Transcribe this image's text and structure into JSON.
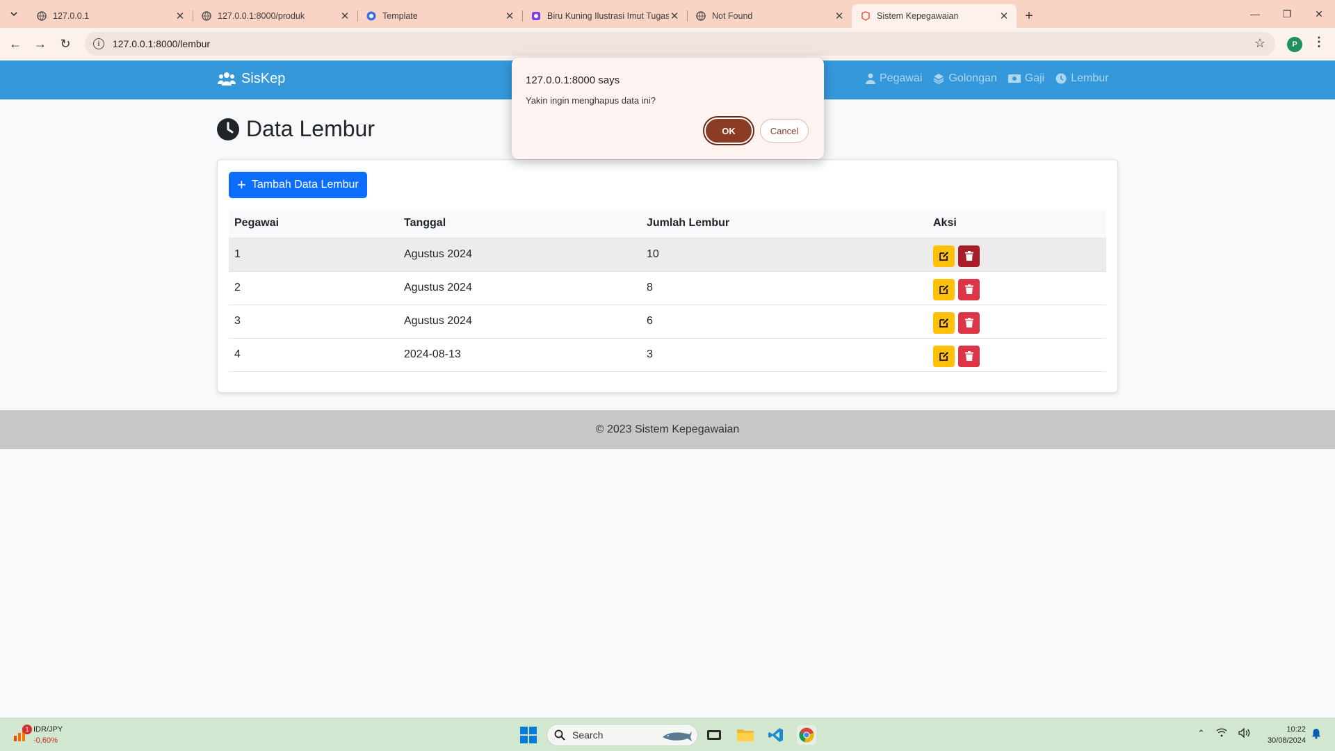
{
  "browser": {
    "tabs": [
      {
        "title": "127.0.0.1",
        "active": false
      },
      {
        "title": "127.0.0.1:8000/produk",
        "active": false
      },
      {
        "title": "Template",
        "active": false
      },
      {
        "title": "Biru Kuning Ilustrasi Imut Tugas",
        "active": false
      },
      {
        "title": "Not Found",
        "active": false
      },
      {
        "title": "Sistem Kepegawaian",
        "active": true
      }
    ],
    "url": "127.0.0.1:8000/lembur",
    "profile_initial": "P"
  },
  "navbar": {
    "brand": "SisKep",
    "links": [
      "Pegawai",
      "Golongan",
      "Gaji",
      "Lembur"
    ]
  },
  "page": {
    "title": "Data Lembur",
    "add_button": "Tambah Data Lembur"
  },
  "table": {
    "headers": [
      "Pegawai",
      "Tanggal",
      "Jumlah Lembur",
      "Aksi"
    ],
    "rows": [
      {
        "pegawai": "1",
        "tanggal": "Agustus 2024",
        "jumlah": "10"
      },
      {
        "pegawai": "2",
        "tanggal": "Agustus 2024",
        "jumlah": "8"
      },
      {
        "pegawai": "3",
        "tanggal": "Agustus 2024",
        "jumlah": "6"
      },
      {
        "pegawai": "4",
        "tanggal": "2024-08-13",
        "jumlah": "3"
      }
    ]
  },
  "footer": {
    "text": "© 2023 Sistem Kepegawaian"
  },
  "dialog": {
    "title": "127.0.0.1:8000 says",
    "message": "Yakin ingin menghapus data ini?",
    "ok": "OK",
    "cancel": "Cancel"
  },
  "taskbar": {
    "widget_badge": "1",
    "widget_title": "IDR/JPY",
    "widget_value": "-0,60%",
    "search_placeholder": "Search",
    "time": "10:22",
    "date": "30/08/2024"
  },
  "colors": {
    "navbar": "#3498db",
    "primary": "#0d6efd",
    "warning": "#ffc107",
    "danger": "#dc3545",
    "dialog_ok": "#8c3b25"
  }
}
